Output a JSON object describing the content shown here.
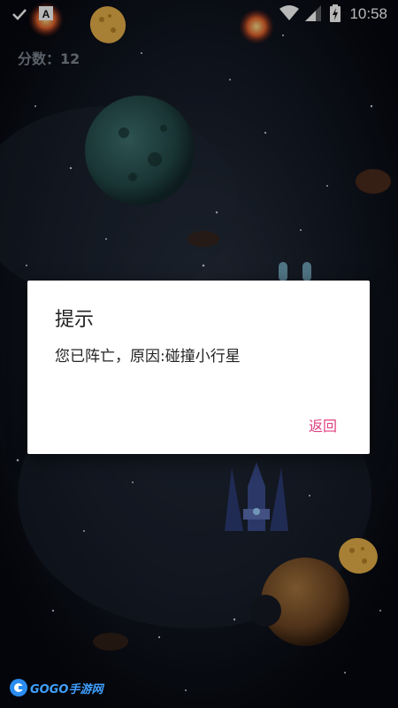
{
  "status_bar": {
    "time": "10:58",
    "icons": [
      "check-icon",
      "a-notification-icon",
      "wifi-icon",
      "signal-icon",
      "battery-charging-icon"
    ]
  },
  "game": {
    "score_text": "分数：12"
  },
  "dialog": {
    "title": "提示",
    "message": "您已阵亡，原因:碰撞小行星",
    "button_label": "返回"
  },
  "watermark": {
    "text": "GOGO手游网"
  },
  "colors": {
    "background": "#07090f",
    "dialog_button": "#e0417f",
    "watermark": "#3fa0ff",
    "score": "#7f8894"
  }
}
